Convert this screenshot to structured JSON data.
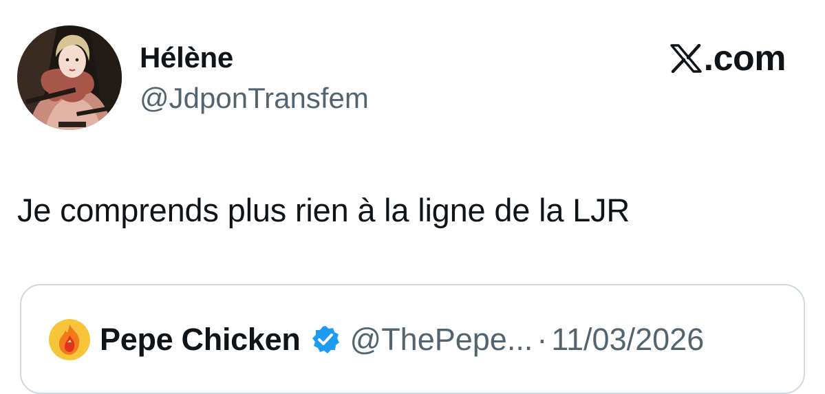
{
  "author": {
    "display_name": "Hélène",
    "handle": "@JdponTransfem",
    "avatar_icon": "portrait-avatar"
  },
  "brand": {
    "icon": "x-logo-icon",
    "label": ".com"
  },
  "tweet": {
    "text": "Je comprends plus rien à la ligne de la LJR"
  },
  "quoted_tweet": {
    "avatar_icon": "rooster-flame-avatar",
    "display_name": "Pepe Chicken",
    "verified_icon": "verified-badge-icon",
    "handle": "@ThePepe...",
    "separator": "·",
    "date": "11/03/2026"
  },
  "colors": {
    "text_primary": "#0f1419",
    "text_secondary": "#536471",
    "border": "#cfd9de",
    "verified_blue": "#1d9bf0"
  }
}
